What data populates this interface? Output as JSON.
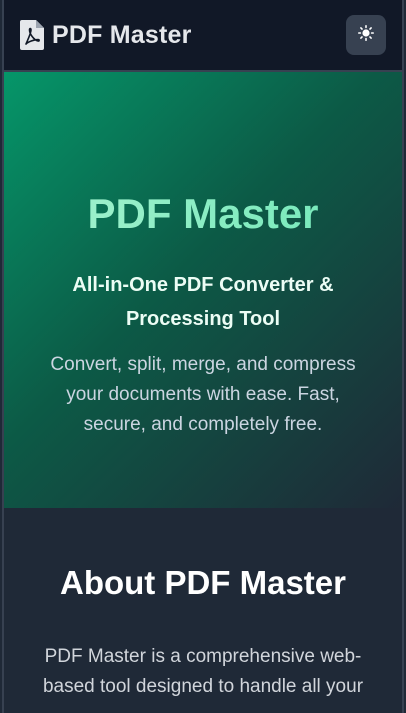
{
  "header": {
    "title": "PDF Master",
    "logo_icon": "file-pdf-icon",
    "theme_toggle_icon": "sun-icon"
  },
  "hero": {
    "title": "PDF Master",
    "subtitle": "All-in-One PDF Converter & Processing Tool",
    "description": "Convert, split, merge, and compress your documents with ease. Fast, secure, and completely free."
  },
  "about": {
    "title": "About PDF Master",
    "text": "PDF Master is a comprehensive web-based tool designed to handle all your"
  },
  "colors": {
    "header_bg": "#111827",
    "hero_gradient_start": "#059669",
    "hero_gradient_end": "#1f2937",
    "hero_title": "#6ee7b7",
    "page_bg": "#1f2937"
  }
}
